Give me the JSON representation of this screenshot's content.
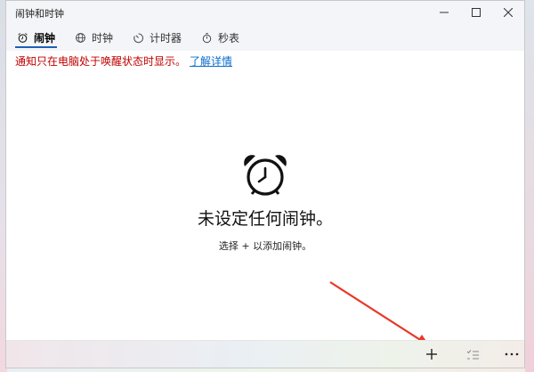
{
  "window": {
    "title": "闹钟和时钟"
  },
  "tabs": [
    {
      "label": "闹钟",
      "icon": "alarm-clock-icon",
      "active": true
    },
    {
      "label": "时钟",
      "icon": "world-clock-icon",
      "active": false
    },
    {
      "label": "计时器",
      "icon": "timer-icon",
      "active": false
    },
    {
      "label": "秒表",
      "icon": "stopwatch-icon",
      "active": false
    }
  ],
  "notice": {
    "text": "通知只在电脑处于唤醒状态时显示。",
    "link": "了解详情"
  },
  "empty_state": {
    "icon": "alarm-clock-icon",
    "title": "未设定任何闹钟。",
    "subtitle": "选择 + 以添加闹钟。"
  },
  "bottom_bar": {
    "actions": [
      "add-icon",
      "select-list-icon",
      "more-icon"
    ]
  },
  "colors": {
    "notice": "#c00000",
    "link": "#0b6ccc",
    "tab_underline": "#1e5fb4",
    "arrow": "#e8392a"
  }
}
